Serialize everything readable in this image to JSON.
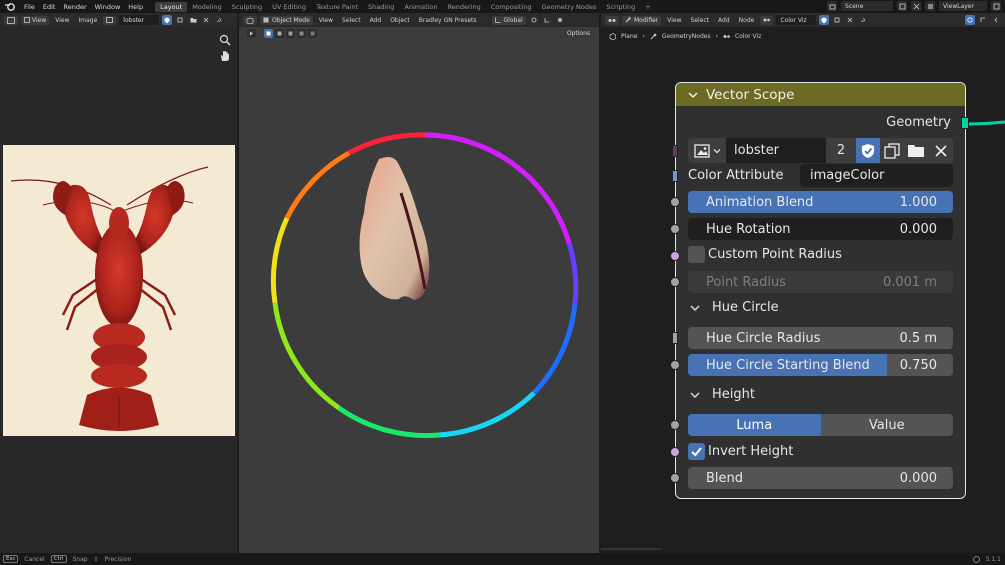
{
  "topbar": {
    "menus": [
      "File",
      "Edit",
      "Render",
      "Window",
      "Help"
    ],
    "workspaces": [
      "Layout",
      "Modeling",
      "Sculpting",
      "UV Editing",
      "Texture Paint",
      "Shading",
      "Animation",
      "Rendering",
      "Compositing",
      "Geometry Nodes",
      "Scripting"
    ],
    "active_workspace": "Layout",
    "add_tab": "+",
    "scene": "Scene",
    "view_layer": "ViewLayer"
  },
  "image_editor": {
    "view_menu": "View",
    "menus": [
      "View",
      "Image"
    ],
    "image_name": "lobster"
  },
  "viewport": {
    "mode": "Object Mode",
    "menus": [
      "View",
      "Select",
      "Add",
      "Object",
      "Bradley GN Presets"
    ],
    "orientation": "Global",
    "options": "Options"
  },
  "node_editor": {
    "editor_type": "Modifier",
    "menus": [
      "View",
      "Select",
      "Add",
      "Node"
    ],
    "node_group": "Color Viz",
    "breadcrumb": [
      "Plane",
      "GeometryNodes",
      "Color Viz"
    ]
  },
  "node": {
    "title": "Vector Scope",
    "output_geometry": "Geometry",
    "image_name": "lobster",
    "image_users": "2",
    "color_attribute_label": "Color Attribute",
    "color_attribute_value": "imageColor",
    "animation_blend_label": "Animation Blend",
    "animation_blend_value": "1.000",
    "animation_blend": 1.0,
    "hue_rotation_label": "Hue Rotation",
    "hue_rotation_value": "0.000",
    "custom_point_radius_label": "Custom Point Radius",
    "custom_point_radius_checked": false,
    "point_radius_label": "Point Radius",
    "point_radius_value": "0.001 m",
    "hue_circle_panel": "Hue Circle",
    "hue_circle_radius_label": "Hue Circle Radius",
    "hue_circle_radius_value": "0.5 m",
    "hue_circle_start_label": "Hue Circle Starting Blend",
    "hue_circle_start_value": "0.750",
    "hue_circle_start_blend": 0.75,
    "height_panel": "Height",
    "height_mode_options": [
      "Luma",
      "Value"
    ],
    "height_mode_selected": "Luma",
    "invert_height_label": "Invert Height",
    "invert_height_checked": true,
    "blend_label": "Blend",
    "blend_value": "0.000"
  },
  "statusbar": {
    "items": [
      {
        "key": "Esc",
        "label": "Cancel"
      },
      {
        "key": "Ctrl",
        "label": "Snap"
      },
      {
        "key": "⇧",
        "label": "Precision"
      }
    ],
    "version": "5.1.1"
  },
  "colors": {
    "node_header": "#6b6b23",
    "accent_blue": "#4772b3",
    "socket_grey": "#a3a3a3",
    "socket_purple": "#c9a6dd",
    "socket_geometry": "#00d6a3",
    "lobster_bg": "#f4ead3"
  }
}
